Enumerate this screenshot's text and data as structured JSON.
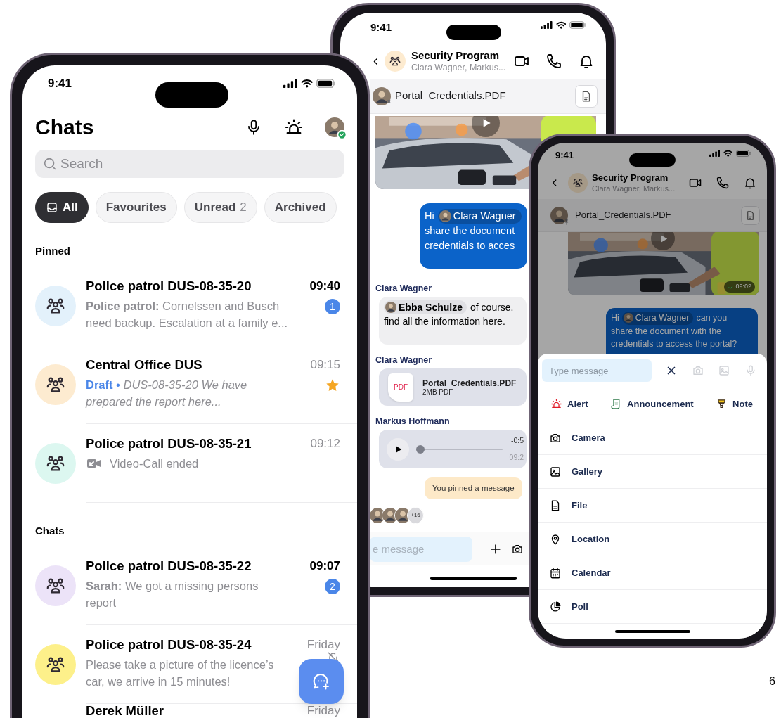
{
  "page_number": "6",
  "chat_list": {
    "status_time": "9:41",
    "title": "Chats",
    "search": {
      "placeholder": "Search"
    },
    "filters": [
      {
        "label": "All",
        "selected": true
      },
      {
        "label": "Favourites",
        "selected": false
      },
      {
        "label": "Unread",
        "count": "2",
        "selected": false
      },
      {
        "label": "Archived",
        "selected": false
      }
    ],
    "sections": [
      {
        "title": "Pinned",
        "chats": [
          {
            "name": "Police patrol DUS-08-35-20",
            "time": "09:40",
            "unread": true,
            "color": "#e3f1fb",
            "kind": "message",
            "preview": "**Police patrol:** Cornelssen and Busch need backup. Escalation at a family e...",
            "badge": "1"
          },
          {
            "name": "Central Office DUS",
            "time": "09:15",
            "unread": false,
            "color": "#fdebd0",
            "kind": "draft",
            "draft_label": "Draft",
            "separator": "•",
            "preview": "DUS-08-35-20 We have prepared the report here...",
            "starred": true
          },
          {
            "name": "Police patrol DUS-08-35-21",
            "time": "09:12",
            "unread": false,
            "color": "#dcf7f0",
            "kind": "call",
            "preview": "Video-Call ended"
          }
        ]
      },
      {
        "title": "Chats",
        "chats": [
          {
            "name": "Police patrol DUS-08-35-22",
            "time": "09:07",
            "unread": true,
            "color": "#ece3f8",
            "kind": "message",
            "preview": "**Sarah:** We got a missing persons report",
            "badge": "2"
          },
          {
            "name": "Police patrol DUS-08-35-24",
            "time": "Friday",
            "unread": false,
            "color": "#fdf08a",
            "kind": "message",
            "preview": "Please take a picture of the licence’s car, we arrive in 15 minutes!",
            "muted": true
          },
          {
            "name": "Derek Müller",
            "time": "Friday",
            "unread": false,
            "kind": "person"
          }
        ]
      }
    ]
  },
  "group_chat": {
    "status_time": "9:41",
    "title": "Security Program",
    "subtitle": "Clara Wagner, Markus...",
    "pinned_file": "Portal_Credentials.PDF",
    "messages": [
      {
        "kind": "video"
      },
      {
        "kind": "outgoing",
        "greeting": "Hi",
        "mention": "Clara Wagner",
        "lines": [
          "share the document",
          "credentials to acces"
        ]
      },
      {
        "kind": "incoming",
        "sender": "Clara Wagner",
        "mention": "Ebba Schulze",
        "first_line": "of course.",
        "lines": [
          "find all the information here."
        ]
      },
      {
        "kind": "file",
        "sender": "Clara Wagner",
        "file_type": "PDF",
        "file_name": "Portal_Credentials.PDF",
        "size": "2MB PDF"
      },
      {
        "kind": "voice",
        "sender": "Markus Hoffmann",
        "remaining": "-0:5",
        "time": "09:2",
        "level": 0
      },
      {
        "kind": "system",
        "text": "You pinned a message"
      }
    ],
    "readers_more": "+16",
    "composer": {
      "placeholder": "e message"
    }
  },
  "attach_phone": {
    "status_time": "9:41",
    "title": "Security Program",
    "subtitle": "Clara Wagner, Markus...",
    "pinned_file": "Portal_Credentials.PDF",
    "video_time": "09:02",
    "message": {
      "greeting": "Hi",
      "mention": "Clara Wagner",
      "first_line": "can you",
      "lines": [
        "share the document with the",
        "credentials to access the portal?"
      ]
    },
    "sheet": {
      "composer": {
        "placeholder": "Type message"
      },
      "quick_actions": [
        {
          "kind": "alert",
          "label": "Alert"
        },
        {
          "kind": "announcement",
          "label": "Announcement"
        },
        {
          "kind": "note",
          "label": "Note"
        }
      ],
      "attachments": [
        {
          "kind": "camera",
          "label": "Camera"
        },
        {
          "kind": "gallery",
          "label": "Gallery"
        },
        {
          "kind": "file",
          "label": "File"
        },
        {
          "kind": "location",
          "label": "Location"
        },
        {
          "kind": "calendar",
          "label": "Calendar"
        },
        {
          "kind": "poll",
          "label": "Poll"
        }
      ]
    }
  }
}
